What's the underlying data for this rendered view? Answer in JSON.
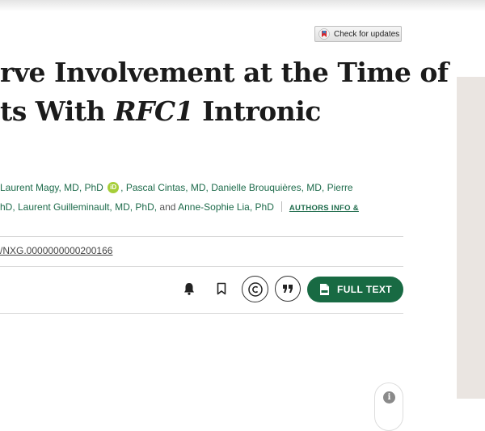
{
  "check_updates": {
    "label": "Check for updates"
  },
  "title": {
    "line1": "rve Involvement at the Time of",
    "line2_prefix": "ts With ",
    "line2_italic": "RFC1",
    "line2_suffix": " Intronic"
  },
  "authors": {
    "line1": {
      "author_a": "Laurent Magy, MD, PhD",
      "orcid_label": "iD",
      "author_b": ", Pascal Cintas, MD, Danielle Brouquières, MD, Pierre"
    },
    "line2": {
      "text_a": "hD, Laurent Guilleminault, MD, PhD,",
      "and": " and ",
      "author_last": "Anne-Sophie Lia, PhD",
      "authors_info": "AUTHORS INFO &"
    }
  },
  "doi": {
    "text": "/NXG.0000000000200166"
  },
  "toolbar": {
    "full_text_label": "FULL TEXT",
    "icons": [
      "bell-icon",
      "bookmark-icon",
      "copyright-icon",
      "quote-icon",
      "pdf-icon"
    ]
  },
  "info_widget": {
    "label": "i"
  },
  "colors": {
    "accent": "#186a43",
    "link": "#1e6b4b",
    "panel": "#eae5e1"
  }
}
